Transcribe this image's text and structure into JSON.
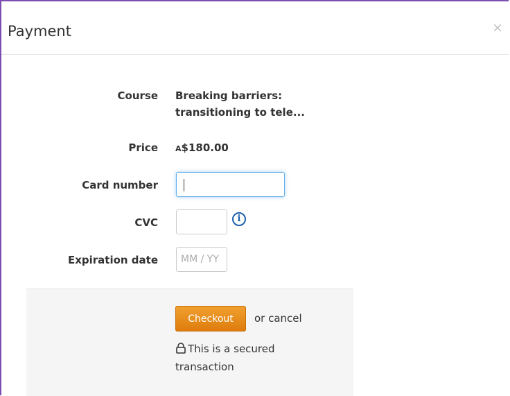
{
  "modal": {
    "title": "Payment",
    "close_symbol": "×"
  },
  "form": {
    "course_label": "Course",
    "course_value": "Breaking barriers: transitioning to tele...",
    "price_label": "Price",
    "price_prefix": "A",
    "price_value": "$180.00",
    "card_number_label": "Card number",
    "card_number_value": "",
    "cvc_label": "CVC",
    "cvc_value": "",
    "cvc_info_icon": "info-icon",
    "expiration_label": "Expiration date",
    "expiration_placeholder": "MM / YY"
  },
  "footer": {
    "checkout_label": "Checkout",
    "cancel_text": "or cancel",
    "secured_text": "This is a secured transaction",
    "lock_icon": "lock-icon"
  },
  "colors": {
    "accent_orange": "#e8901c",
    "info_blue": "#1d5fae",
    "focus_blue": "#66afe9",
    "panel_gray": "#f5f5f5"
  }
}
